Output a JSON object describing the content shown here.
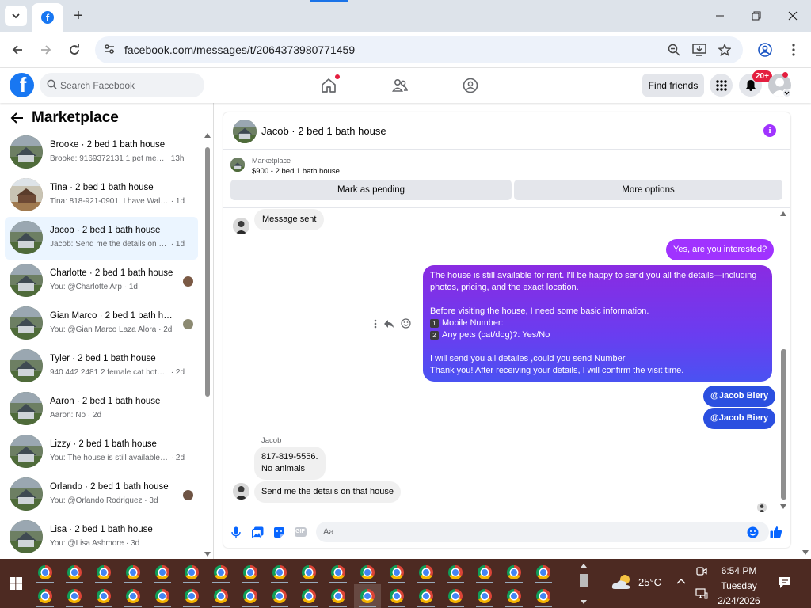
{
  "browser": {
    "url": "facebook.com/messages/t/2064373980771459",
    "new_tab_symbol": "+"
  },
  "header": {
    "search_placeholder": "Search Facebook",
    "find_friends_label": "Find friends",
    "notification_count": "20+"
  },
  "sidebar": {
    "title": "Marketplace",
    "conversations": [
      {
        "name": "Brooke · 2 bed 1 bath house",
        "preview": "Brooke: 9169372131 1 pet mediu...",
        "time": "13h",
        "thumb": "house-green"
      },
      {
        "name": "Tina · 2 bed 1 bath house",
        "preview": "Tina: 818-921-0901. I have Waldo ...",
        "time": "1d",
        "thumb": "house-brown"
      },
      {
        "name": "Jacob · 2 bed 1 bath house",
        "preview": "Jacob: Send me the details on that...",
        "time": "1d",
        "thumb": "house-green",
        "active": true
      },
      {
        "name": "Charlotte · 2 bed 1 bath house",
        "preview": "You: @Charlotte Arp",
        "time": "1d",
        "thumb": "house-green"
      },
      {
        "name": "Gian Marco · 2 bed 1 bath house",
        "preview": "You: @Gian Marco Laza Alora",
        "time": "2d",
        "thumb": "house-green"
      },
      {
        "name": "Tyler · 2 bed 1 bath house",
        "preview": "940 442 2481 2 female cat both h...",
        "time": "2d",
        "thumb": "house-green"
      },
      {
        "name": "Aaron · 2 bed 1 bath house",
        "preview": "Aaron: No",
        "time": "2d",
        "thumb": "house-green"
      },
      {
        "name": "Lizzy · 2 bed 1 bath house",
        "preview": "You: The house is still available for ...",
        "time": "2d",
        "thumb": "house-green"
      },
      {
        "name": "Orlando · 2 bed 1 bath house",
        "preview": "You: @Orlando Rodriguez",
        "time": "3d",
        "thumb": "house-green"
      },
      {
        "name": "Lisa · 2 bed 1 bath house",
        "preview": "You: @Lisa Ashmore",
        "time": "3d",
        "thumb": "house-green"
      }
    ]
  },
  "chat": {
    "title": "Jacob · 2 bed 1 bath house",
    "listing_label": "Marketplace",
    "listing_price_title": "$900 - 2 bed 1 bath house",
    "mark_pending_label": "Mark as pending",
    "more_options_label": "More options",
    "messages": {
      "sent_note": "Message sent",
      "out1": "Yes, are you interested?",
      "out2_line1": "The house is still available for rent. I'll be happy to send you all the details—including photos, pricing, and the exact location.",
      "out2_line2": "Before visiting the house, I need some basic information.",
      "out2_item1_num": "1",
      "out2_item1": "Mobile Number:",
      "out2_item2_num": "2",
      "out2_item2": "Any pets (cat/dog)?: Yes/No",
      "out2_line3": "I will send you all detailes ,could you send Number",
      "out2_line4": "Thank you! After receiving your details, I will confirm the visit time.",
      "mention1": "@Jacob Biery",
      "mention2": "@Jacob Biery",
      "sender_name": "Jacob",
      "in_phone": "817-819-5556.",
      "in_pets": "No animals",
      "in_last": "Send me the details on that house"
    },
    "composer_placeholder": "Aa",
    "gif_label": "GIF"
  },
  "taskbar": {
    "temperature": "25°C",
    "time": "6:54 PM",
    "day": "Tuesday",
    "date": "2/24/2026"
  },
  "colors": {
    "facebook_blue": "#1877f2",
    "messenger_purple": "#a033ff",
    "active_row": "#ebf5ff",
    "taskbar": "#4d2a22"
  }
}
